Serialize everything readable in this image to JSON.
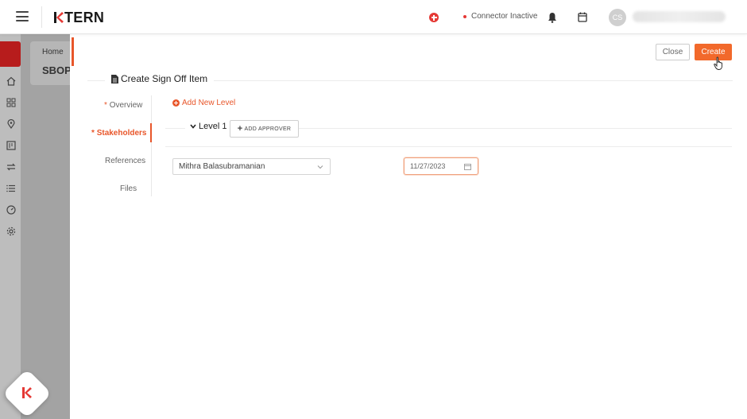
{
  "app": {
    "logo_text": "TERN",
    "connector_status": "Connector Inactive",
    "avatar_initials": "CS"
  },
  "breadcrumb": {
    "home": "Home",
    "page": "SBOP"
  },
  "actions": {
    "close_label": "Close",
    "create_label": "Create"
  },
  "form": {
    "title": "Create Sign Off Item",
    "nav": [
      {
        "label": "Overview",
        "required": "*"
      },
      {
        "label": "Stakeholders",
        "required": "*"
      },
      {
        "label": "References"
      },
      {
        "label": "Files"
      }
    ],
    "add_level_label": "Add New Level",
    "level_label": "Level 1",
    "add_approver_label": "ADD APPROVER",
    "approver_value": "Mithra Balasubramanian",
    "date_value": "11/27/2023"
  },
  "colors": {
    "accent": "#f2692b",
    "status_dot": "#e53935",
    "rail_active": "#b71c1c"
  }
}
